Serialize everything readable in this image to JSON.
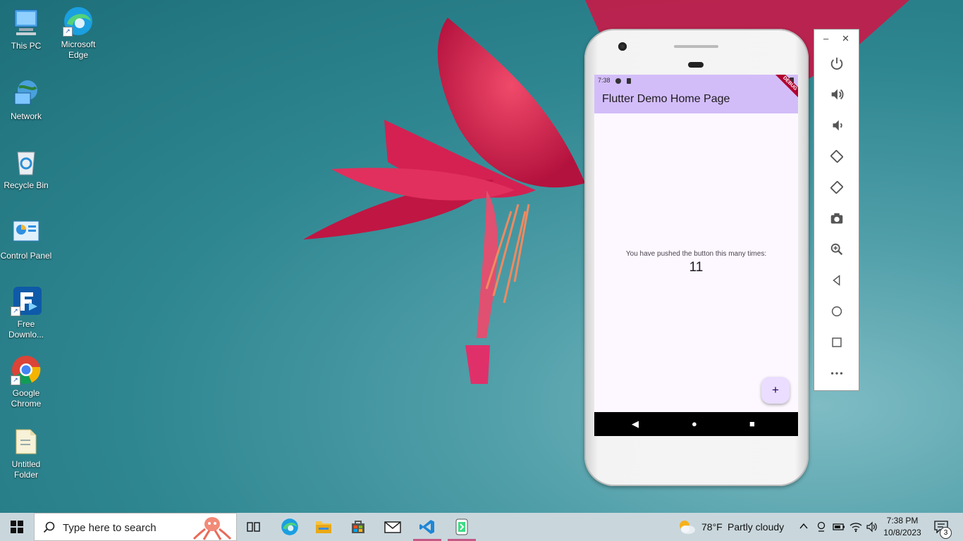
{
  "desktop": {
    "icons": [
      {
        "label": "This PC",
        "icon": "computer-icon"
      },
      {
        "label": "Microsoft Edge",
        "icon": "edge-icon"
      },
      {
        "label": "Network",
        "icon": "network-icon"
      },
      {
        "label": "Recycle Bin",
        "icon": "recycle-bin-icon"
      },
      {
        "label": "Control Panel",
        "icon": "control-panel-icon"
      },
      {
        "label": "Free Downlo...",
        "icon": "free-download-manager-icon"
      },
      {
        "label": "Google Chrome",
        "icon": "chrome-icon"
      },
      {
        "label": "Untitled Folder",
        "icon": "folder-icon"
      }
    ]
  },
  "phone": {
    "status_time": "7:38",
    "debug_banner": "DEBUG",
    "app_title": "Flutter Demo Home Page",
    "message": "You have pushed the button this many times:",
    "counter": "11",
    "fab_label": "+",
    "nav": {
      "back": "◀",
      "home": "●",
      "recents": "■"
    }
  },
  "emulator_toolbar": {
    "minimize": "–",
    "close": "✕",
    "buttons": [
      "power",
      "volume-up",
      "volume-down",
      "rotate-left",
      "rotate-right",
      "screenshot",
      "zoom",
      "back",
      "home",
      "overview",
      "more"
    ]
  },
  "taskbar": {
    "search_placeholder": "Type here to search",
    "weather_temp": "78°F",
    "weather_desc": "Partly cloudy",
    "time": "7:38 PM",
    "date": "10/8/2023",
    "notifications": "3"
  },
  "colors": {
    "appbar": "#d3bdf9",
    "fab": "#eaddff",
    "taskbar": "#c9d7dd",
    "active_indicator": "#c35a86"
  }
}
